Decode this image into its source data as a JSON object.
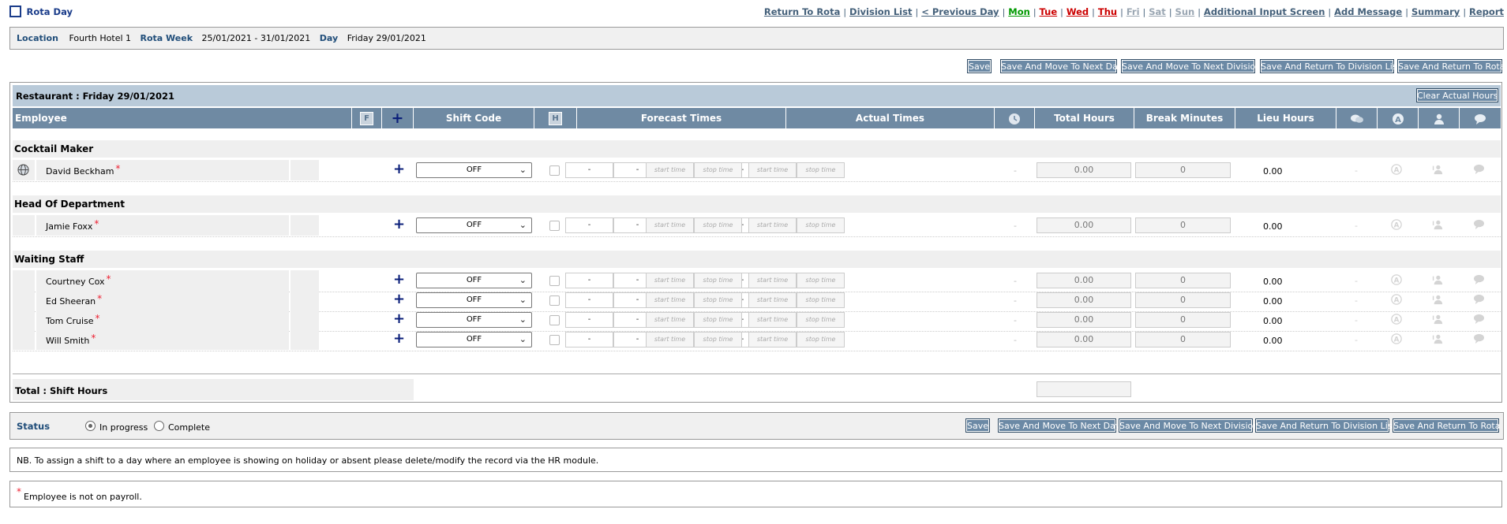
{
  "page": {
    "title": "Rota Day"
  },
  "nav": {
    "links": [
      {
        "label": "Return To Rota",
        "style": "normal"
      },
      {
        "label": "Division List",
        "style": "normal"
      },
      {
        "label": "< Previous Day",
        "style": "normal"
      },
      {
        "label": "Mon",
        "style": "green"
      },
      {
        "label": "Tue",
        "style": "red"
      },
      {
        "label": "Wed",
        "style": "red"
      },
      {
        "label": "Thu",
        "style": "red"
      },
      {
        "label": "Fri",
        "style": "grey"
      },
      {
        "label": "Sat",
        "style": "grey"
      },
      {
        "label": "Sun",
        "style": "grey"
      },
      {
        "label": "Additional Input Screen",
        "style": "normal"
      },
      {
        "label": "Add Message",
        "style": "normal"
      },
      {
        "label": "Summary",
        "style": "normal"
      },
      {
        "label": "Report",
        "style": "normal"
      }
    ]
  },
  "info": {
    "location_label": "Location",
    "location_value": "Fourth Hotel 1",
    "week_label": "Rota Week",
    "week_value": "25/01/2021 - 31/01/2021",
    "day_label": "Day",
    "day_value": "Friday 29/01/2021"
  },
  "actions": {
    "save": "Save",
    "next_day": "Save And Move To Next Day",
    "next_division": "Save And Move To Next Division",
    "return_division": "Save And Return To Division List",
    "return_rota": "Save And Return To Rota"
  },
  "section": {
    "title": "Restaurant : Friday 29/01/2021",
    "clear_button": "Clear Actual Hours"
  },
  "table": {
    "headers": {
      "employee": "Employee",
      "f": "F",
      "plus": "+",
      "shift_code": "Shift Code",
      "h": "H",
      "forecast": "Forecast Times",
      "actual": "Actual Times",
      "total": "Total Hours",
      "break": "Break Minutes",
      "lieu": "Lieu Hours"
    },
    "placeholders": {
      "start": "start time",
      "stop": "stop time"
    },
    "empty_time": "-",
    "groups": [
      {
        "name": "Cocktail Maker",
        "rows": [
          {
            "name": "David Beckham",
            "shift": "OFF",
            "total": "0.00",
            "break": "0",
            "lieu": "0.00",
            "globe": true
          }
        ]
      },
      {
        "name": "Head Of Department",
        "rows": [
          {
            "name": "Jamie Foxx",
            "shift": "OFF",
            "total": "0.00",
            "break": "0",
            "lieu": "0.00"
          }
        ]
      },
      {
        "name": "Waiting Staff",
        "rows": [
          {
            "name": "Courtney Cox",
            "shift": "OFF",
            "total": "0.00",
            "break": "0",
            "lieu": "0.00"
          },
          {
            "name": "Ed Sheeran",
            "shift": "OFF",
            "total": "0.00",
            "break": "0",
            "lieu": "0.00"
          },
          {
            "name": "Tom Cruise",
            "shift": "OFF",
            "total": "0.00",
            "break": "0",
            "lieu": "0.00"
          },
          {
            "name": "Will Smith",
            "shift": "OFF",
            "total": "0.00",
            "break": "0",
            "lieu": "0.00"
          }
        ]
      }
    ],
    "total_label": "Total : Shift Hours",
    "star": "*"
  },
  "status": {
    "label": "Status",
    "options": [
      "In progress",
      "Complete"
    ],
    "selected": "In progress"
  },
  "notes": {
    "nb": "NB. To assign a shift to a day where an employee is showing on holiday or absent please delete/modify the record via the HR module.",
    "legend_star": "*",
    "legend": "Employee is not on payroll."
  },
  "colors": {
    "header": "#6f8aa3",
    "button": "#6b89a5",
    "section": "#b9cad9",
    "label": "#214e7a"
  }
}
